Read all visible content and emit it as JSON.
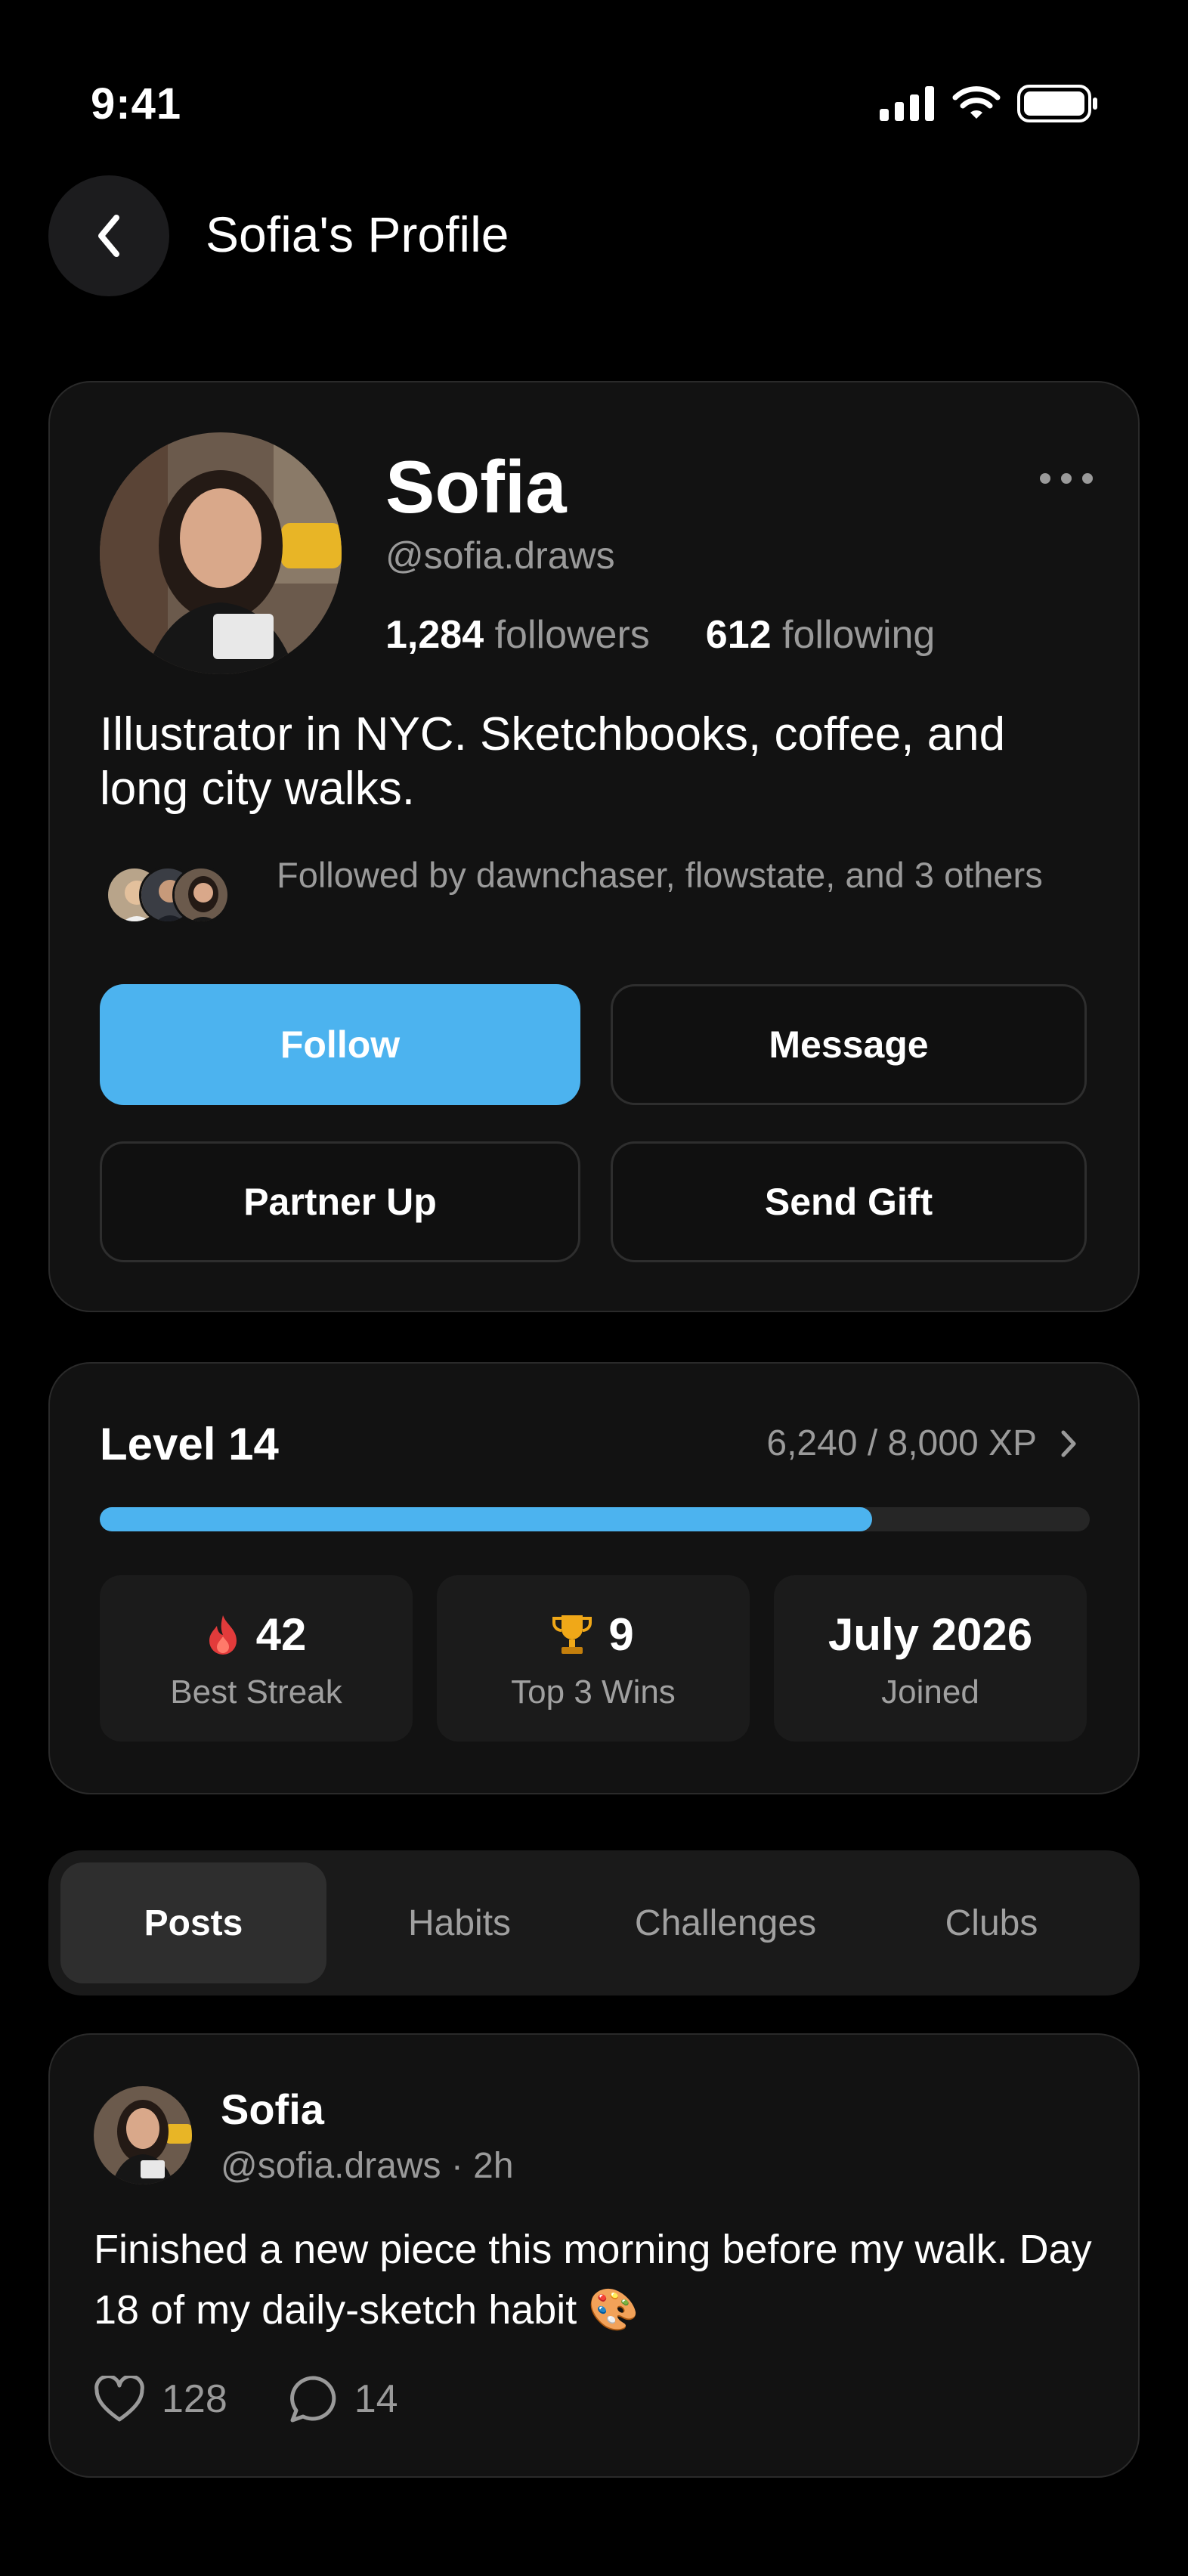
{
  "status_bar": {
    "time": "9:41"
  },
  "header": {
    "title": "Sofia's Profile"
  },
  "profile": {
    "name": "Sofia",
    "handle": "@sofia.draws",
    "followers_count": "1,284",
    "followers_label": "followers",
    "following_count": "612",
    "following_label": "following",
    "bio": "Illustrator in NYC. Sketchbooks, coffee, and long city walks.",
    "followed_by": "Followed by dawnchaser, flowstate, and 3 others",
    "buttons": {
      "follow": "Follow",
      "message": "Message",
      "partner_up": "Partner Up",
      "send_gift": "Send Gift"
    }
  },
  "level": {
    "title": "Level 14",
    "xp": "6,240 / 8,000 XP",
    "progress_fraction": 0.78,
    "stats": [
      {
        "icon": "flame-icon",
        "value": "42",
        "label": "Best Streak"
      },
      {
        "icon": "trophy-icon",
        "value": "9",
        "label": "Top 3 Wins"
      },
      {
        "icon": "",
        "value": "July 2026",
        "label": "Joined"
      }
    ]
  },
  "tabs": [
    {
      "label": "Posts",
      "active": true
    },
    {
      "label": "Habits",
      "active": false
    },
    {
      "label": "Challenges",
      "active": false
    },
    {
      "label": "Clubs",
      "active": false
    }
  ],
  "post": {
    "author": "Sofia",
    "meta": "@sofia.draws · 2h",
    "text": "Finished a new piece this morning before my walk. Day 18 of my daily-sketch habit 🎨",
    "likes": "128",
    "comments": "14"
  },
  "colors": {
    "accent": "#4cb3ef",
    "background": "#000000",
    "card": "#121212"
  }
}
